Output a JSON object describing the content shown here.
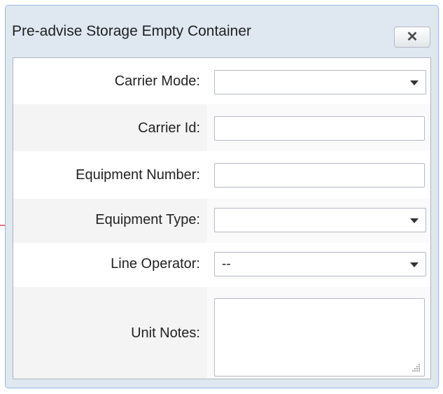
{
  "dialog": {
    "title": "Pre-advise Storage Empty Container",
    "close_label": "✕"
  },
  "form": {
    "fields": [
      {
        "label": "Carrier Mode:",
        "type": "select",
        "value": ""
      },
      {
        "label": "Carrier Id:",
        "type": "text",
        "value": ""
      },
      {
        "label": "Equipment Number:",
        "type": "text",
        "value": ""
      },
      {
        "label": "Equipment Type:",
        "type": "select",
        "value": ""
      },
      {
        "label": "Line Operator:",
        "type": "select",
        "value": "--"
      },
      {
        "label": "Unit Notes:",
        "type": "textarea",
        "value": ""
      }
    ]
  },
  "colors": {
    "dialog_bg": "#dfe8f1",
    "dialog_border": "#99bbe8",
    "arrow": "#cc2222"
  }
}
